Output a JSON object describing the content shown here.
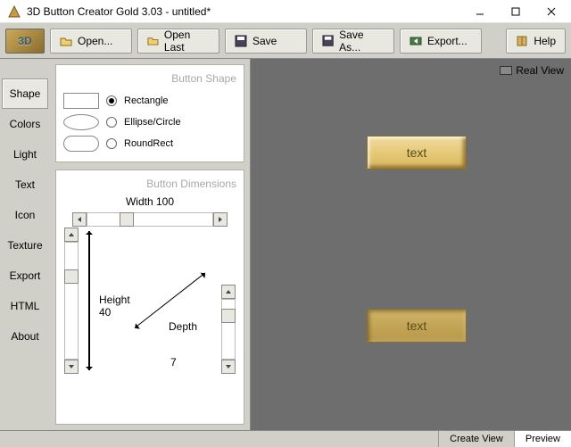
{
  "window": {
    "title": "3D Button Creator Gold 3.03 - untitled*"
  },
  "toolbar": {
    "logo": "3D",
    "open": "Open...",
    "open_last": "Open Last",
    "save": "Save",
    "save_as": "Save As...",
    "export": "Export...",
    "help": "Help"
  },
  "sidebar": {
    "items": [
      {
        "label": "Shape",
        "active": true
      },
      {
        "label": "Colors"
      },
      {
        "label": "Light"
      },
      {
        "label": "Text"
      },
      {
        "label": "Icon"
      },
      {
        "label": "Texture"
      },
      {
        "label": "Export"
      },
      {
        "label": "HTML"
      },
      {
        "label": "About"
      }
    ]
  },
  "shape_panel": {
    "title": "Button Shape",
    "options": [
      {
        "label": "Rectangle",
        "selected": true
      },
      {
        "label": "Ellipse/Circle",
        "selected": false
      },
      {
        "label": "RoundRect",
        "selected": false
      }
    ]
  },
  "dimensions_panel": {
    "title": "Button Dimensions",
    "width_label": "Width 100",
    "height_label": "Height",
    "height_value": "40",
    "depth_label": "Depth",
    "depth_value": "7"
  },
  "preview": {
    "real_view": "Real View",
    "button_text": "text"
  },
  "footer": {
    "create_view": "Create View",
    "preview": "Preview"
  },
  "colors": {
    "chrome": "#d0d0c8",
    "gold_light": "#e6c978",
    "gold_dark": "#b89848",
    "preview_bg": "#6e6e6e"
  }
}
